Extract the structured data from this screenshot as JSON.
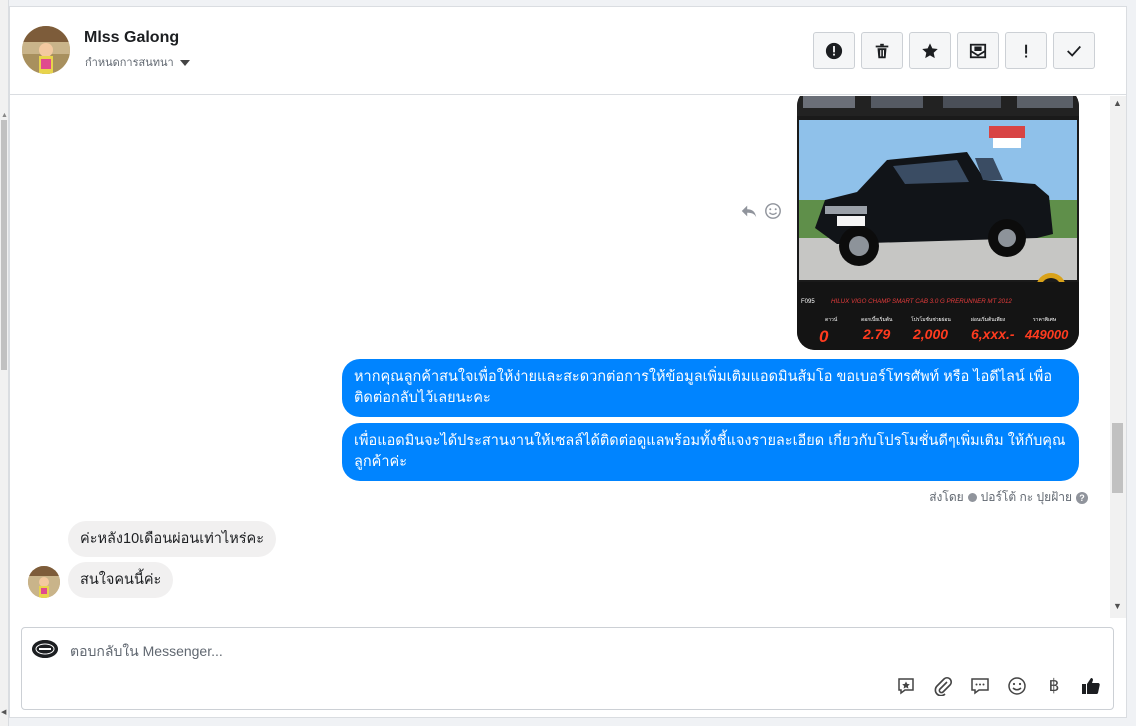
{
  "header": {
    "contact_name": "Mlss Galong",
    "conversation_settings": "กำหนดการสนทนา"
  },
  "toolbar": {
    "buttons": [
      "report-spam",
      "delete",
      "star",
      "mark-unread",
      "mark-important",
      "mark-done"
    ]
  },
  "thread": {
    "image_caption": "HILUX VIGO CHAMP SMART CAB 3.0 G PRERUNNER MT 2012",
    "image_stats": {
      "down_label": "ดาวน์",
      "down_value": "0",
      "rate_label": "ดอกเบี้ยเริ่มต้น",
      "rate_value": "2.79",
      "promo_label": "โปรโมชั่นช่วยผ่อน",
      "promo_value": "2,000",
      "installment_label": "ผ่อนเริ่มต้นเพียง",
      "installment_value": "6,xxx.-",
      "price_label": "ราคาพิเศษ",
      "price_value": "449000",
      "code": "F095"
    },
    "outgoing": [
      "หากคุณลูกค้าสนใจเพื่อให้ง่ายและสะดวกต่อการให้ข้อมูลเพิ่มเติมแอดมินส้มโอ ขอเบอร์โทรศัพท์ หรือ ไอดีไลน์ เพื่อติดต่อกลับไว้เลยนะคะ",
      "เพื่อแอดมินจะได้ประสานงานให้เซลล์ได้ติดต่อดูแลพร้อมทั้งชี้แจงรายละเอียด เกี่ยวกับโปรโมชั่นดีๆเพิ่มเติม ให้กับคุณลูกค้าค่ะ"
    ],
    "sent_by_prefix": "ส่งโดย",
    "sent_by_name": "ปอร์โต้ กะ ปุยฝ้าย",
    "incoming": [
      "ค่ะหลัง10เดือนผ่อนเท่าไหร่คะ",
      "สนใจคนนี้ค่ะ"
    ]
  },
  "composer": {
    "placeholder": "ตอบกลับใน Messenger...",
    "currency_symbol": "฿"
  },
  "colors": {
    "outgoing_bubble": "#0084ff",
    "incoming_bubble": "#f1f0f0"
  }
}
